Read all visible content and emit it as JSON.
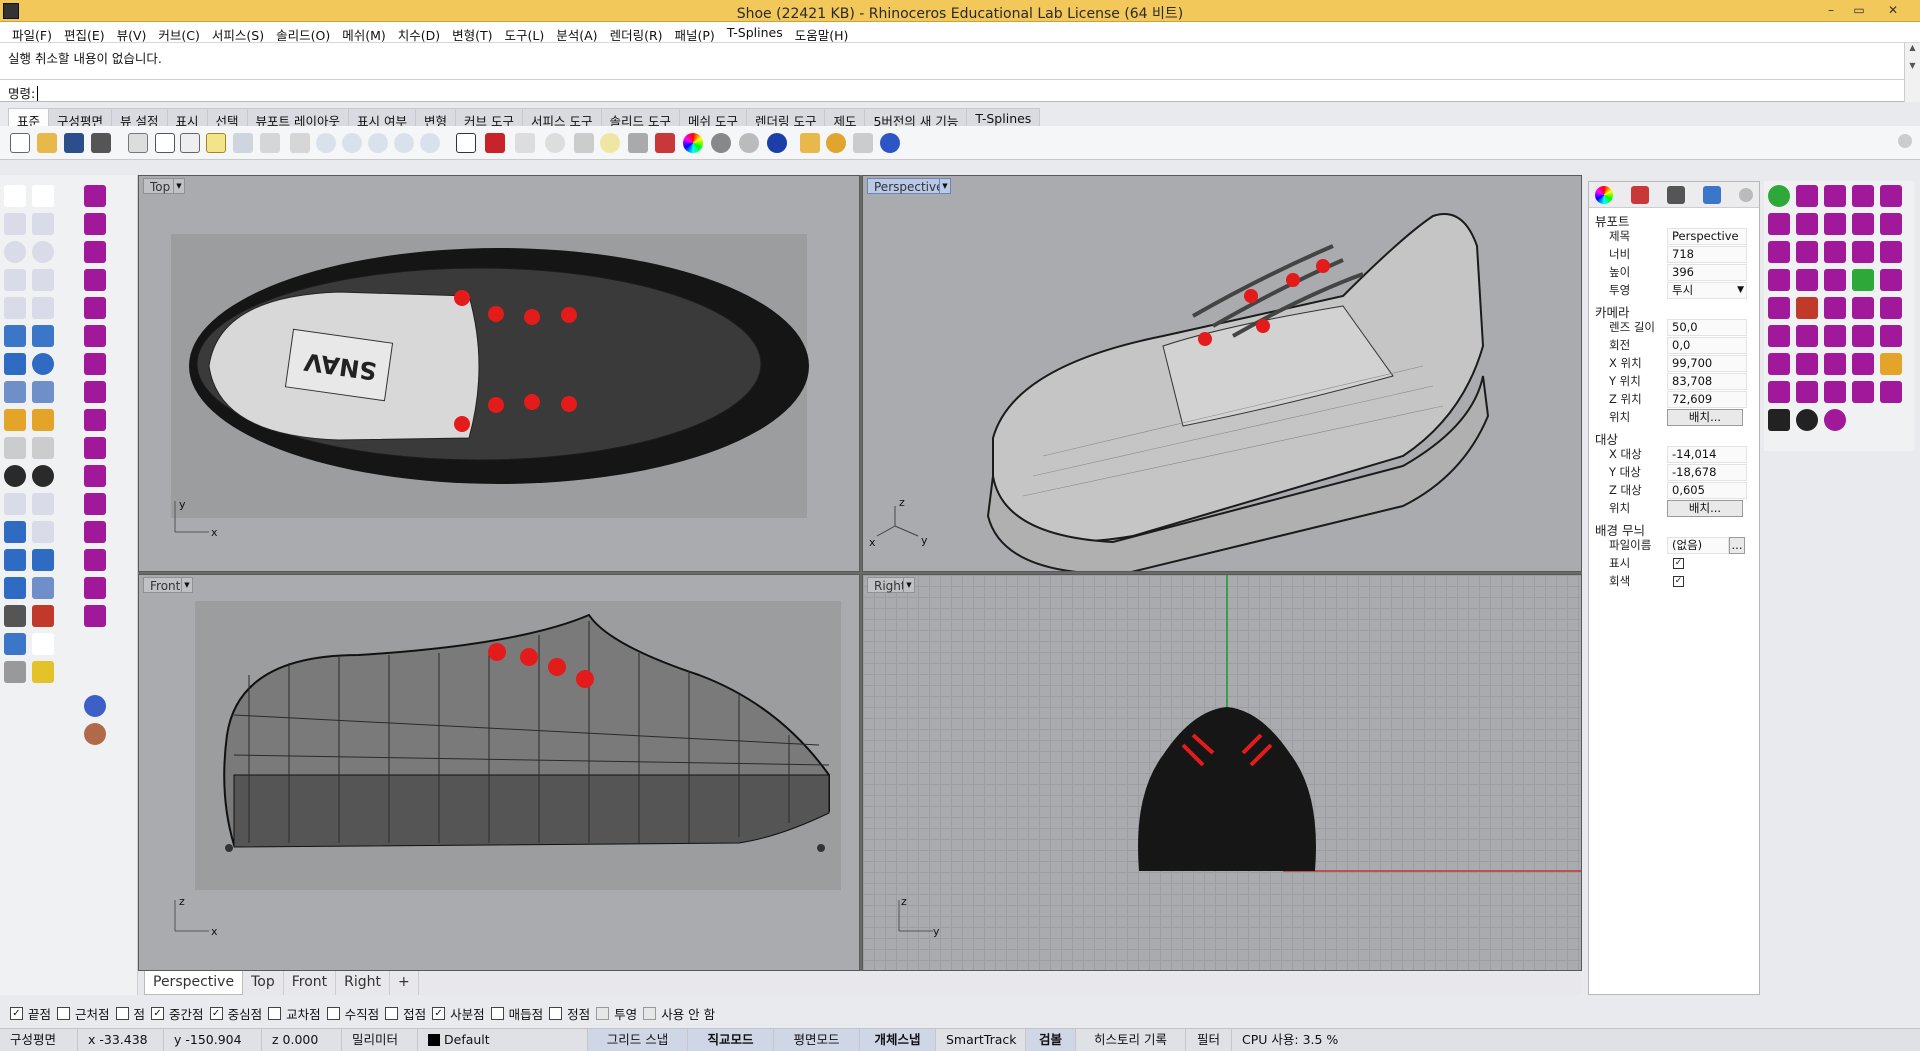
{
  "window": {
    "title": "Shoe (22421 KB) - Rhinoceros Educational Lab License (64 비트)",
    "controls": [
      "–",
      "▭",
      "✕"
    ]
  },
  "menu": [
    "파일(F)",
    "편집(E)",
    "뷰(V)",
    "커브(C)",
    "서피스(S)",
    "솔리드(O)",
    "메쉬(M)",
    "치수(D)",
    "변형(T)",
    "도구(L)",
    "분석(A)",
    "렌더링(R)",
    "패널(P)",
    "T-Splines",
    "도움말(H)"
  ],
  "history": {
    "text": "실행 취소할 내용이 없습니다."
  },
  "command": {
    "prompt": "명령:"
  },
  "toolbar_tabs": [
    "표준",
    "구성평면",
    "뷰 설정",
    "표시",
    "선택",
    "뷰포트 레이아웃",
    "표시 여부",
    "변형",
    "커브 도구",
    "서피스 도구",
    "솔리드 도구",
    "메쉬 도구",
    "렌더링 도구",
    "제도",
    "5버전의 새 기능",
    "T-Splines"
  ],
  "viewports": {
    "top": "Top",
    "perspective": "Perspective",
    "front": "Front",
    "right": "Right"
  },
  "axes": {
    "x": "x",
    "y": "y",
    "z": "z"
  },
  "viewport_tabs": [
    "Perspective",
    "Top",
    "Front",
    "Right",
    "+"
  ],
  "panel": {
    "viewport_section": "뷰포트",
    "title_label": "제목",
    "title_value": "Perspective",
    "width_label": "너비",
    "width_value": "718",
    "height_label": "높이",
    "height_value": "396",
    "projection_label": "투영",
    "projection_value": "투시",
    "camera_section": "카메라",
    "lens_label": "렌즈 길이",
    "lens_value": "50,0",
    "rotation_label": "회전",
    "rotation_value": "0,0",
    "xpos_label": "X 위치",
    "xpos_value": "99,700",
    "ypos_label": "Y 위치",
    "ypos_value": "83,708",
    "zpos_label": "Z 위치",
    "zpos_value": "72,609",
    "position_label": "위치",
    "place_button": "배치...",
    "target_section": "대상",
    "xt_label": "X 대상",
    "xt_value": "-14,014",
    "yt_label": "Y 대상",
    "yt_value": "-18,678",
    "zt_label": "Z 대상",
    "zt_value": "0,605",
    "target_position_label": "위치",
    "target_place_button": "배치...",
    "bg_section": "배경 무늬",
    "filename_label": "파일이름",
    "filename_value": "(없음)",
    "browse_button": "...",
    "show_label": "표시",
    "gray_label": "회색"
  },
  "osnap": [
    {
      "label": "끝점",
      "checked": true
    },
    {
      "label": "근처점",
      "checked": false
    },
    {
      "label": "점",
      "checked": false
    },
    {
      "label": "중간점",
      "checked": true
    },
    {
      "label": "중심점",
      "checked": true
    },
    {
      "label": "교차점",
      "checked": false
    },
    {
      "label": "수직점",
      "checked": false
    },
    {
      "label": "접점",
      "checked": false
    },
    {
      "label": "사분점",
      "checked": true
    },
    {
      "label": "매듭점",
      "checked": false
    },
    {
      "label": "정점",
      "checked": false
    },
    {
      "label": "투영",
      "checked": false
    },
    {
      "label": "사용 안 함",
      "checked": false
    }
  ],
  "status": {
    "cplane": "구성평면",
    "x": "x -33.438",
    "y": "y -150.904",
    "z": "z 0.000",
    "units": "밀리미터",
    "layer": "Default",
    "grid_snap": "그리드 스냅",
    "ortho": "직교모드",
    "planar": "평면모드",
    "osnap": "개체스냅",
    "smarttrack": "SmartTrack",
    "gumball": "검볼",
    "history": "히스토리 기록",
    "filter": "필터",
    "cpu": "CPU 사용: 3.5 %"
  },
  "colors": {
    "titlebar": "#f2c85a",
    "viewport_bg": "#a9abae",
    "highlight": "#e41b1b",
    "accent_purple": "#a2189a"
  }
}
